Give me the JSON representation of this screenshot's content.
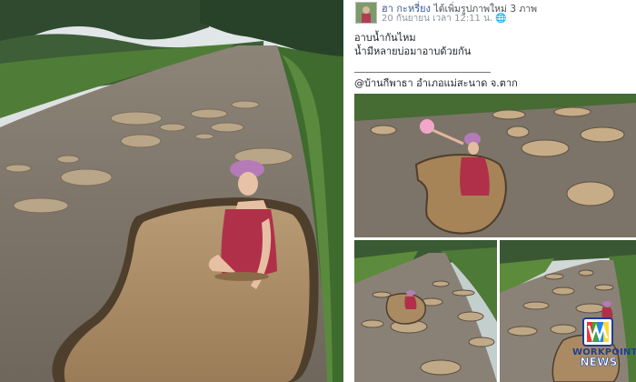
{
  "post": {
    "author_name": "ฮา กะหรี่ยง",
    "author_action": "ได้เพิ่มรูปภาพใหม่ 3 ภาพ",
    "timestamp": "20 กันยายน เวลา 12:11 น.",
    "line1": "อาบน้ำกันไหม",
    "line2": "น้ำมีหลายบ่อมาอาบด้วยกัน",
    "location": "@บ้านกีพาธา อำเภอแม่สะนาด จ.ตาก"
  },
  "watermark": {
    "line1": "WORKPOINT",
    "line2": "NEWS"
  },
  "colors": {
    "link": "#3b5998",
    "brand": "#1c3f94"
  }
}
